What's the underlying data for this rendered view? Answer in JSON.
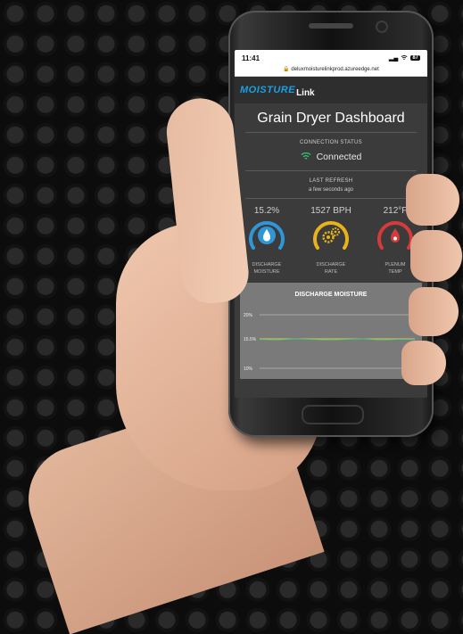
{
  "status_bar": {
    "time": "11:41",
    "battery": "87"
  },
  "url": "deluxmoisturelinkprod.azureedge.net",
  "brand": {
    "part1": "MOISTURE",
    "part2": "Link"
  },
  "page_title": "Grain Dryer Dashboard",
  "connection": {
    "label": "CONNECTION STATUS",
    "value": "Connected"
  },
  "refresh": {
    "label": "LAST REFRESH",
    "value": "a few seconds ago"
  },
  "gauges": [
    {
      "value": "15.2%",
      "label1": "DISCHARGE",
      "label2": "MOISTURE",
      "color": "#2f96d8",
      "icon": "water-drop-icon"
    },
    {
      "value": "1527 BPH",
      "label1": "DISCHARGE",
      "label2": "RATE",
      "color": "#e8b21c",
      "icon": "gears-icon"
    },
    {
      "value": "212°F",
      "label1": "PLENUM",
      "label2": "TEMP",
      "color": "#d63a3a",
      "icon": "flame-drop-icon"
    }
  ],
  "colors": {
    "accent": "#1aa0e0",
    "connected": "#2ecc71"
  },
  "chart_data": {
    "type": "line",
    "title": "DISCHARGE MOISTURE",
    "ytick_labels": [
      "20%",
      "15.5%",
      "10%"
    ],
    "ylim": [
      10,
      20
    ],
    "series": [
      {
        "values": [
          15.5,
          15.5,
          15.5,
          15.5,
          15.5,
          15.5,
          15.5,
          15.5,
          15.5,
          15.5
        ],
        "color": "#e0c44a"
      },
      {
        "values": [
          15.4,
          15.3,
          15.5,
          15.4,
          15.3,
          15.4,
          15.5,
          15.3,
          15.4,
          15.4
        ],
        "color": "#4fc27a"
      }
    ]
  }
}
